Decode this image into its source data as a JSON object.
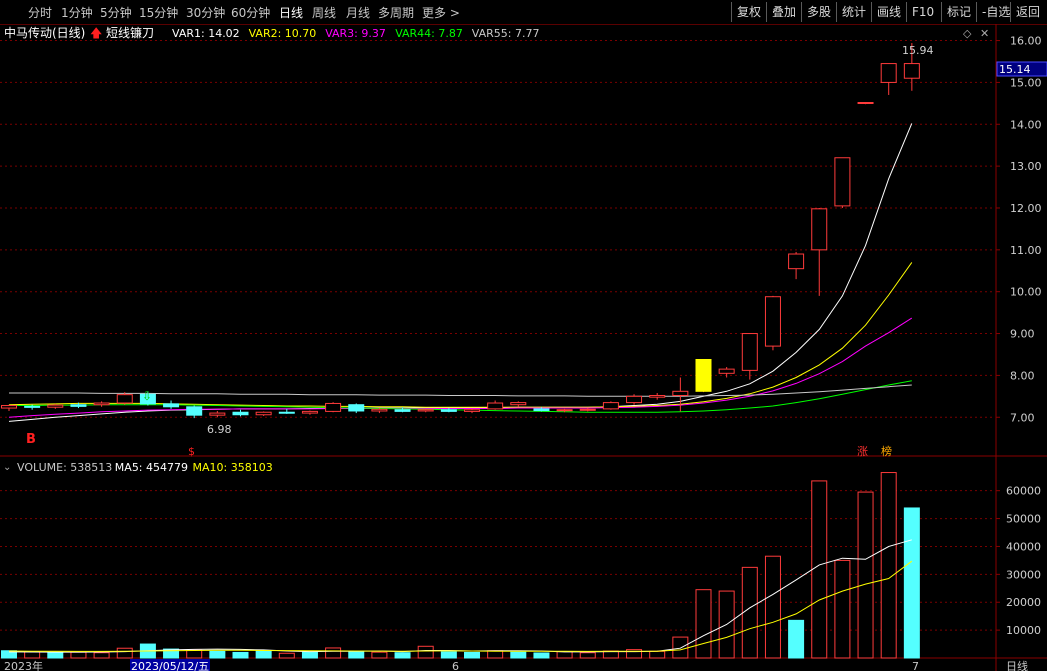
{
  "toolbar": {
    "periods": [
      "分时",
      "1分钟",
      "5分钟",
      "15分钟",
      "30分钟",
      "60分钟",
      "日线",
      "周线",
      "月线",
      "多周期",
      "更多 >"
    ],
    "active_period": "日线",
    "right_buttons": [
      "复权",
      "叠加",
      "多股",
      "统计",
      "画线",
      "F10",
      "标记",
      "-自选",
      "返回"
    ]
  },
  "chart_data": [
    {
      "type": "candlestick",
      "title": "中马传动(日线)",
      "indicator": "短线镰刀",
      "indicator_values": [
        {
          "name": "VAR1",
          "value": "14.02",
          "color": "#ffffff"
        },
        {
          "name": "VAR2",
          "value": "10.70",
          "color": "#ffff00"
        },
        {
          "name": "VAR3",
          "value": "9.37",
          "color": "#ff00ff"
        },
        {
          "name": "VAR44",
          "value": "7.87",
          "color": "#00ff00"
        },
        {
          "name": "VAR55",
          "value": "7.77",
          "color": "#c8c8c8"
        }
      ],
      "y_ticks": [
        "16.00",
        "15.00",
        "14.00",
        "13.00",
        "12.00",
        "11.00",
        "10.00",
        "9.00",
        "8.00",
        "7.00"
      ],
      "ylim": [
        6.6,
        16.3
      ],
      "current_price": "15.14",
      "high_label": "15.94",
      "low_label": "6.98",
      "markers": {
        "buy": "B",
        "sell": "$",
        "limit_up": "涨",
        "hot": "榜"
      },
      "candles": [
        {
          "o": 7.22,
          "h": 7.3,
          "l": 7.15,
          "c": 7.28
        },
        {
          "o": 7.26,
          "h": 7.3,
          "l": 7.18,
          "c": 7.24
        },
        {
          "o": 7.24,
          "h": 7.32,
          "l": 7.2,
          "c": 7.29
        },
        {
          "o": 7.3,
          "h": 7.35,
          "l": 7.22,
          "c": 7.26
        },
        {
          "o": 7.3,
          "h": 7.38,
          "l": 7.25,
          "c": 7.34
        },
        {
          "o": 7.34,
          "h": 7.6,
          "l": 7.3,
          "c": 7.54
        },
        {
          "o": 7.55,
          "h": 7.62,
          "l": 7.28,
          "c": 7.32
        },
        {
          "o": 7.32,
          "h": 7.4,
          "l": 7.2,
          "c": 7.25
        },
        {
          "o": 7.25,
          "h": 7.28,
          "l": 6.98,
          "c": 7.05
        },
        {
          "o": 7.05,
          "h": 7.15,
          "l": 7.0,
          "c": 7.1
        },
        {
          "o": 7.12,
          "h": 7.18,
          "l": 7.02,
          "c": 7.06
        },
        {
          "o": 7.06,
          "h": 7.14,
          "l": 7.03,
          "c": 7.12
        },
        {
          "o": 7.12,
          "h": 7.2,
          "l": 7.08,
          "c": 7.1
        },
        {
          "o": 7.1,
          "h": 7.16,
          "l": 7.06,
          "c": 7.14
        },
        {
          "o": 7.14,
          "h": 7.36,
          "l": 7.12,
          "c": 7.33
        },
        {
          "o": 7.3,
          "h": 7.33,
          "l": 7.1,
          "c": 7.15
        },
        {
          "o": 7.15,
          "h": 7.22,
          "l": 7.1,
          "c": 7.19
        },
        {
          "o": 7.18,
          "h": 7.24,
          "l": 7.12,
          "c": 7.14
        },
        {
          "o": 7.15,
          "h": 7.2,
          "l": 7.12,
          "c": 7.18
        },
        {
          "o": 7.18,
          "h": 7.22,
          "l": 7.12,
          "c": 7.14
        },
        {
          "o": 7.14,
          "h": 7.2,
          "l": 7.1,
          "c": 7.18
        },
        {
          "o": 7.2,
          "h": 7.4,
          "l": 7.18,
          "c": 7.34
        },
        {
          "o": 7.3,
          "h": 7.38,
          "l": 7.25,
          "c": 7.35
        },
        {
          "o": 7.2,
          "h": 7.24,
          "l": 7.14,
          "c": 7.16
        },
        {
          "o": 7.16,
          "h": 7.2,
          "l": 7.12,
          "c": 7.18
        },
        {
          "o": 7.17,
          "h": 7.22,
          "l": 7.14,
          "c": 7.19
        },
        {
          "o": 7.2,
          "h": 7.38,
          "l": 7.18,
          "c": 7.35
        },
        {
          "o": 7.35,
          "h": 7.55,
          "l": 7.3,
          "c": 7.5
        },
        {
          "o": 7.48,
          "h": 7.58,
          "l": 7.42,
          "c": 7.52
        },
        {
          "o": 7.52,
          "h": 7.95,
          "l": 7.14,
          "c": 7.62
        },
        {
          "o": 7.62,
          "h": 8.38,
          "l": 7.6,
          "c": 8.38
        },
        {
          "o": 8.05,
          "h": 8.2,
          "l": 7.95,
          "c": 8.15
        },
        {
          "o": 8.12,
          "h": 9.0,
          "l": 7.9,
          "c": 9.0
        },
        {
          "o": 8.7,
          "h": 9.9,
          "l": 8.6,
          "c": 9.88
        },
        {
          "o": 10.55,
          "h": 10.95,
          "l": 10.3,
          "c": 10.9
        },
        {
          "o": 11.0,
          "h": 12.0,
          "l": 9.9,
          "c": 11.98
        },
        {
          "o": 12.05,
          "h": 13.2,
          "l": 12.0,
          "c": 13.2
        },
        {
          "o": 14.5,
          "h": 14.52,
          "l": 14.48,
          "c": 14.52
        },
        {
          "o": 15.0,
          "h": 15.45,
          "l": 14.7,
          "c": 15.45
        },
        {
          "o": 15.1,
          "h": 15.94,
          "l": 14.8,
          "c": 15.45
        }
      ],
      "lines": [
        {
          "name": "VAR1",
          "color": "#ffffff",
          "values": [
            6.9,
            6.95,
            7.0,
            7.04,
            7.08,
            7.12,
            7.15,
            7.17,
            7.18,
            7.19,
            7.2,
            7.2,
            7.2,
            7.21,
            7.22,
            7.22,
            7.22,
            7.22,
            7.22,
            7.22,
            7.22,
            7.23,
            7.24,
            7.24,
            7.24,
            7.24,
            7.25,
            7.28,
            7.31,
            7.38,
            7.5,
            7.62,
            7.8,
            8.1,
            8.55,
            9.1,
            9.9,
            11.1,
            12.7,
            14.02
          ]
        },
        {
          "name": "VAR2",
          "color": "#ffff00",
          "values": [
            7.3,
            7.31,
            7.32,
            7.33,
            7.33,
            7.33,
            7.33,
            7.32,
            7.31,
            7.3,
            7.29,
            7.28,
            7.27,
            7.27,
            7.26,
            7.26,
            7.25,
            7.25,
            7.24,
            7.24,
            7.24,
            7.24,
            7.24,
            7.24,
            7.24,
            7.24,
            7.25,
            7.26,
            7.28,
            7.31,
            7.37,
            7.45,
            7.56,
            7.72,
            7.95,
            8.25,
            8.65,
            9.2,
            9.92,
            10.7
          ]
        },
        {
          "name": "VAR3",
          "color": "#ff00ff",
          "values": [
            7.0,
            7.04,
            7.07,
            7.1,
            7.13,
            7.15,
            7.17,
            7.18,
            7.19,
            7.19,
            7.2,
            7.2,
            7.2,
            7.2,
            7.21,
            7.21,
            7.21,
            7.21,
            7.21,
            7.21,
            7.21,
            7.21,
            7.22,
            7.22,
            7.22,
            7.22,
            7.23,
            7.24,
            7.26,
            7.29,
            7.34,
            7.41,
            7.5,
            7.63,
            7.81,
            8.04,
            8.33,
            8.7,
            9.02,
            9.37
          ]
        },
        {
          "name": "VAR44",
          "color": "#00ff00",
          "values": [
            7.28,
            7.28,
            7.29,
            7.29,
            7.3,
            7.3,
            7.3,
            7.3,
            7.29,
            7.28,
            7.27,
            7.26,
            7.25,
            7.24,
            7.23,
            7.22,
            7.21,
            7.2,
            7.19,
            7.18,
            7.17,
            7.16,
            7.15,
            7.14,
            7.13,
            7.12,
            7.12,
            7.12,
            7.12,
            7.13,
            7.15,
            7.18,
            7.22,
            7.27,
            7.35,
            7.44,
            7.55,
            7.66,
            7.77,
            7.87
          ]
        },
        {
          "name": "VAR55",
          "color": "#c8c8c8",
          "values": [
            7.58,
            7.58,
            7.58,
            7.58,
            7.57,
            7.57,
            7.57,
            7.56,
            7.56,
            7.56,
            7.55,
            7.55,
            7.55,
            7.54,
            7.54,
            7.54,
            7.53,
            7.53,
            7.53,
            7.52,
            7.52,
            7.52,
            7.51,
            7.51,
            7.51,
            7.5,
            7.5,
            7.5,
            7.5,
            7.5,
            7.51,
            7.52,
            7.53,
            7.55,
            7.58,
            7.61,
            7.65,
            7.69,
            7.73,
            7.77
          ]
        }
      ]
    },
    {
      "type": "bar",
      "title": "VOLUME",
      "indicator_values": [
        {
          "name": "VOLUME",
          "value": "538513",
          "color": "#c8c8c8"
        },
        {
          "name": "MA5",
          "value": "454779",
          "color": "#ffffff"
        },
        {
          "name": "MA10",
          "value": "358103",
          "color": "#ffff00"
        }
      ],
      "y_ticks": [
        "60000",
        "50000",
        "40000",
        "30000",
        "20000",
        "10000"
      ],
      "ylim": [
        0,
        71000
      ],
      "x_labels": [
        "2023年",
        "2023/05/12/五",
        "6",
        "7"
      ],
      "right_label": "日线",
      "volumes": [
        {
          "v": 2600,
          "up": false
        },
        {
          "v": 2200,
          "up": true
        },
        {
          "v": 1800,
          "up": false
        },
        {
          "v": 2100,
          "up": true
        },
        {
          "v": 1900,
          "up": true
        },
        {
          "v": 3500,
          "up": true
        },
        {
          "v": 5000,
          "up": false
        },
        {
          "v": 3200,
          "up": false
        },
        {
          "v": 2800,
          "up": true
        },
        {
          "v": 2400,
          "up": false
        },
        {
          "v": 2000,
          "up": false
        },
        {
          "v": 2600,
          "up": false
        },
        {
          "v": 1700,
          "up": true
        },
        {
          "v": 2200,
          "up": false
        },
        {
          "v": 3600,
          "up": true
        },
        {
          "v": 2300,
          "up": false
        },
        {
          "v": 2100,
          "up": true
        },
        {
          "v": 1900,
          "up": false
        },
        {
          "v": 4200,
          "up": true
        },
        {
          "v": 2200,
          "up": false
        },
        {
          "v": 2000,
          "up": false
        },
        {
          "v": 2600,
          "up": true
        },
        {
          "v": 2100,
          "up": false
        },
        {
          "v": 1800,
          "up": false
        },
        {
          "v": 2300,
          "up": true
        },
        {
          "v": 1900,
          "up": true
        },
        {
          "v": 2500,
          "up": true
        },
        {
          "v": 3000,
          "up": true
        },
        {
          "v": 2400,
          "up": true
        },
        {
          "v": 7500,
          "up": true
        },
        {
          "v": 24500,
          "up": true
        },
        {
          "v": 24000,
          "up": true
        },
        {
          "v": 32500,
          "up": true
        },
        {
          "v": 36500,
          "up": true
        },
        {
          "v": 13500,
          "up": false
        },
        {
          "v": 63500,
          "up": true
        },
        {
          "v": 35000,
          "up": true
        },
        {
          "v": 59500,
          "up": true
        },
        {
          "v": 66500,
          "up": true
        },
        {
          "v": 53800,
          "up": false
        }
      ],
      "ma5": [
        2200,
        2150,
        2100,
        2120,
        2150,
        2300,
        2600,
        2900,
        3100,
        3200,
        3100,
        2900,
        2500,
        2300,
        2400,
        2400,
        2500,
        2300,
        2700,
        2700,
        2500,
        2600,
        2600,
        2500,
        2200,
        2200,
        2300,
        2300,
        2400,
        3500,
        8000,
        12000,
        18000,
        22800,
        28000,
        33400,
        35800,
        35400,
        40000,
        42400
      ],
      "ma10": [
        2500,
        2450,
        2400,
        2380,
        2360,
        2400,
        2500,
        2600,
        2700,
        2750,
        2750,
        2700,
        2650,
        2600,
        2550,
        2500,
        2480,
        2450,
        2500,
        2550,
        2500,
        2450,
        2450,
        2400,
        2400,
        2350,
        2400,
        2400,
        2450,
        2900,
        5200,
        7400,
        10500,
        12800,
        15800,
        20800,
        24000,
        26500,
        28500,
        34700
      ]
    }
  ]
}
